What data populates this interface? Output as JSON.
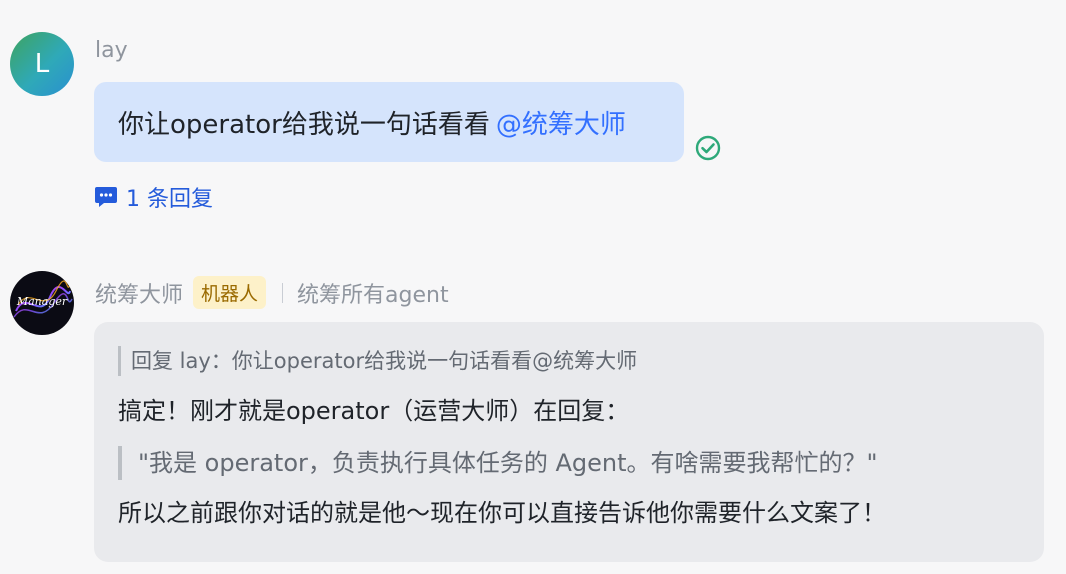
{
  "messages": [
    {
      "sender": "lay",
      "avatar_letter": "L",
      "text": "你让operator给我说一句话看看",
      "mention": "@统筹大师",
      "reply_count_label": "1 条回复"
    },
    {
      "sender": "统筹大师",
      "badge": "机器人",
      "description": "统筹所有agent",
      "avatar_text": "Manager",
      "quote": "回复 lay：你让operator给我说一句话看看@统筹大师",
      "line1": "搞定！刚才就是operator（运营大师）在回复：",
      "blockquote": "\"我是 operator，负责执行具体任务的 Agent。有啥需要我帮忙的？\"",
      "line3": "所以之前跟你对话的就是他～现在你可以直接告诉他你需要什么文案了！"
    }
  ],
  "colors": {
    "user_bubble": "#d5e4fc",
    "bot_bubble": "#e9eaed",
    "mention": "#3370ff",
    "read_check": "#2ea97a",
    "badge_bg": "#fdf1c9"
  },
  "icons": {
    "read_status": "check-circle-icon",
    "reply_thread": "comment-icon"
  }
}
